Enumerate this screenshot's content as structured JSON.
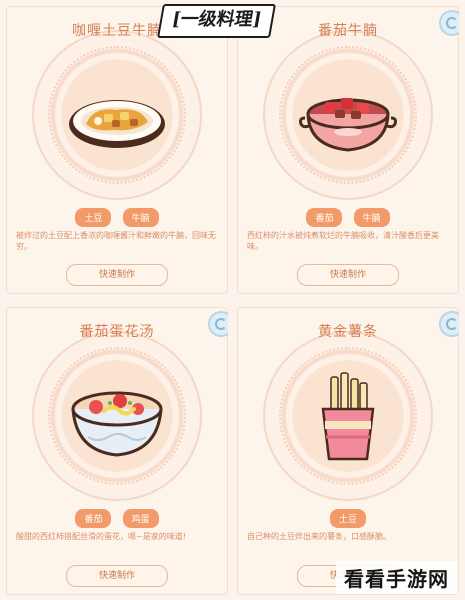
{
  "banner": {
    "text": "[一级料理]"
  },
  "recipes": [
    {
      "name": "咖喱土豆牛腩",
      "tags": [
        "土豆",
        "牛腩"
      ],
      "description": "被炸过的土豆配上香浓的咖喱酱汁和鲜嫩的牛腩，回味无穷。",
      "button": "快速制作",
      "dish_icon": "curry-plate-icon"
    },
    {
      "name": "番茄牛腩",
      "tags": [
        "番茄",
        "牛腩"
      ],
      "description": "西红柿的汁水被炖煮软烂的牛腩吸收，清汁酸香后更美味。",
      "button": "快速制作",
      "dish_icon": "tomato-beef-pot-icon"
    },
    {
      "name": "番茄蛋花汤",
      "tags": [
        "番茄",
        "鸡蛋"
      ],
      "description": "酸甜的西红柿搭配丝滑的蛋花，嗯~是家的味道!",
      "button": "快速制作",
      "dish_icon": "tomato-egg-soup-bowl-icon"
    },
    {
      "name": "黄金薯条",
      "tags": [
        "土豆"
      ],
      "description": "自己种的土豆炸出来的薯条，口感酥脆。",
      "button": "快速制作",
      "dish_icon": "french-fries-icon"
    }
  ],
  "watermark": {
    "text": "看看手游网"
  },
  "colors": {
    "accent": "#f29a68",
    "title": "#d77f52",
    "background": "#fdf4ec"
  }
}
